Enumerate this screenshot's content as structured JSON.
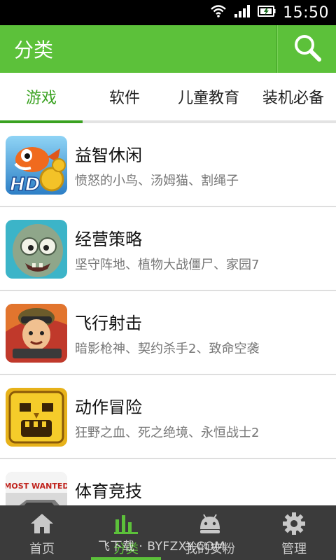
{
  "status_bar": {
    "time": "15:50"
  },
  "header": {
    "title": "分类",
    "search_icon": "search-icon"
  },
  "tabs": [
    {
      "label": "游戏",
      "active": true
    },
    {
      "label": "软件",
      "active": false
    },
    {
      "label": "儿童教育",
      "active": false
    },
    {
      "label": "装机必备",
      "active": false
    }
  ],
  "categories": [
    {
      "title": "益智休闲",
      "subtitle": "愤怒的小鸟、汤姆猫、割绳子",
      "icon_text": "HD"
    },
    {
      "title": "经营策略",
      "subtitle": "坚守阵地、植物大战僵尸、家园7"
    },
    {
      "title": "飞行射击",
      "subtitle": "暗影枪神、契约杀手2、致命空袭"
    },
    {
      "title": "动作冒险",
      "subtitle": "狂野之血、死之绝境、永恒战士2"
    },
    {
      "title": "体育竞技",
      "subtitle": "",
      "icon_text": "MOST WANTED"
    }
  ],
  "bottom_nav": [
    {
      "label": "首页",
      "icon": "home-icon",
      "active": false
    },
    {
      "label": "分类",
      "icon": "bar-chart-icon",
      "active": true
    },
    {
      "label": "我的安粉",
      "icon": "android-icon",
      "active": false
    },
    {
      "label": "管理",
      "icon": "gear-icon",
      "active": false
    }
  ],
  "watermark": "飞下载 · BYFZXY.COM",
  "colors": {
    "accent": "#5cc13a",
    "tab_active": "#3aa221",
    "nav_bg": "#3b3b3b"
  }
}
